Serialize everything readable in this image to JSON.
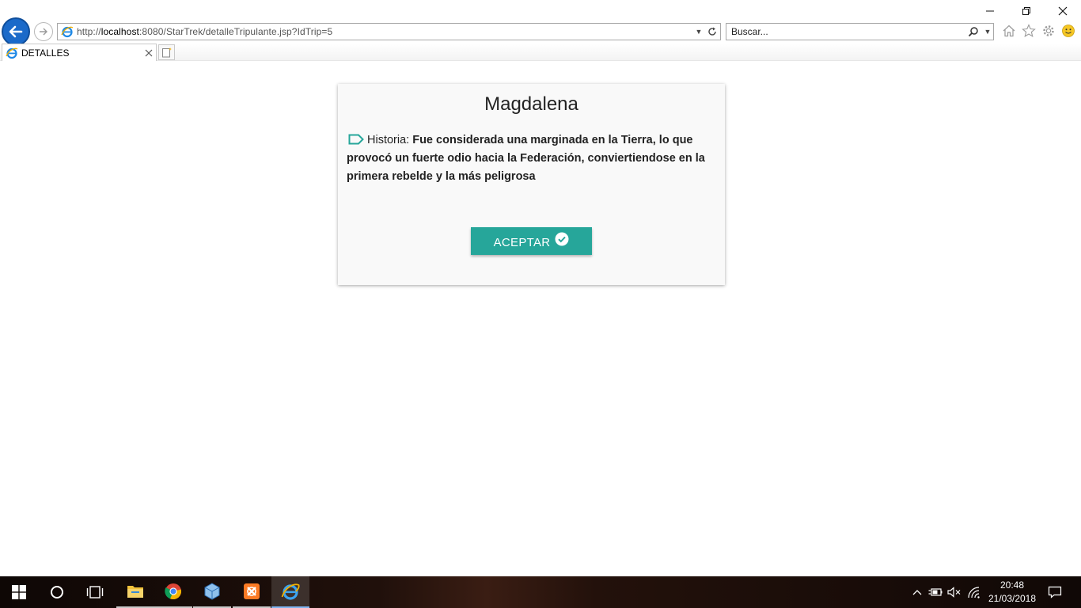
{
  "browser": {
    "address": {
      "prefix": "http://",
      "host": "localhost",
      "rest": ":8080/StarTrek/detalleTripulante.jsp?IdTrip=5"
    },
    "search_placeholder": "Buscar...",
    "tab_title": "DETALLES"
  },
  "card": {
    "title": "Magdalena",
    "story_label": "Historia:",
    "story_text": "Fue considerada una marginada en la Tierra, lo que provocó un fuerte odio hacia la Federación, conviertiendose en la primera rebelde y la más peligrosa",
    "accept_label": "ACEPTAR"
  },
  "taskbar": {
    "time": "20:48",
    "date": "21/03/2018"
  },
  "colors": {
    "accent_teal": "#26a69a",
    "ie_blue": "#1b6ac9"
  }
}
